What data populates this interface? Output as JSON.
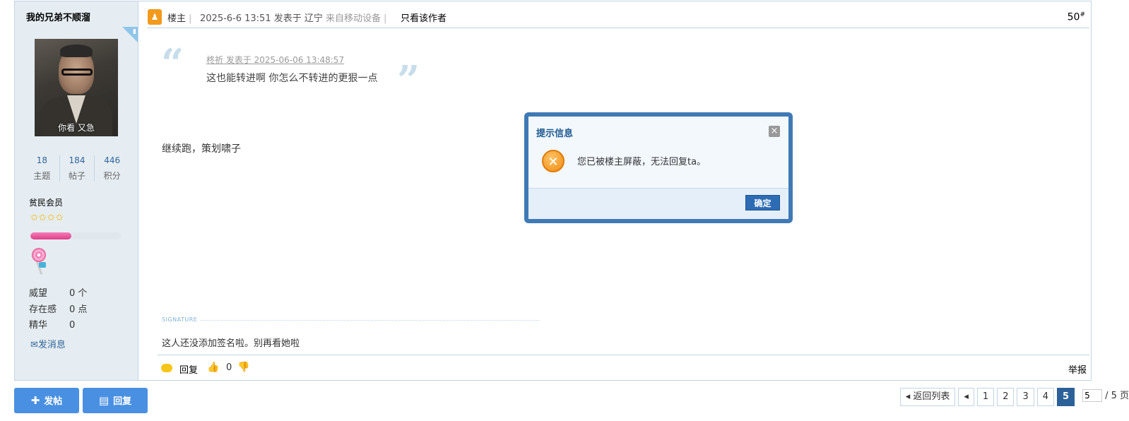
{
  "user": {
    "name": "我的兄弟不顺溜",
    "mobile_badge_icon": "mobile-icon",
    "avatar_caption": "你看 又急",
    "stats": [
      {
        "value": "18",
        "label": "主题"
      },
      {
        "value": "184",
        "label": "帖子"
      },
      {
        "value": "446",
        "label": "积分"
      }
    ],
    "group": "贫民会员",
    "stars": "✩✩✩✩",
    "progress_fraction": 0.45,
    "info": [
      {
        "key": "威望",
        "value": "0 个"
      },
      {
        "key": "存在感",
        "value": "0 点"
      },
      {
        "key": "精华",
        "value": "0"
      }
    ],
    "send_message": "发消息"
  },
  "post": {
    "author_role": "楼主",
    "date": "2025-6-6 13:51",
    "posted_in": "发表于 辽宁",
    "from_device": "来自移动设备",
    "only_author": "只看该作者",
    "floor": "50",
    "floor_sup": "#",
    "quote": {
      "meta": "柊祈 发表于 2025-06-06 13:48:57",
      "text": "这也能转进啊 你怎么不转进的更狠一点"
    },
    "body": "继续跑，策划啸子",
    "signature_label": "SIGNATURE",
    "signature": "这人还没添加签名啦。别再看她啦",
    "reply": "回复",
    "likes": "0",
    "report": "举报"
  },
  "actions": {
    "new_post": "发帖",
    "reply": "回复"
  },
  "pager": {
    "back": "返回列表",
    "pages": [
      "1",
      "2",
      "3",
      "4"
    ],
    "current": "5",
    "input_value": "5",
    "total": "/ 5 页"
  },
  "dialog": {
    "title": "提示信息",
    "message": "您已被楼主屏蔽，无法回复ta。",
    "ok": "确定"
  }
}
